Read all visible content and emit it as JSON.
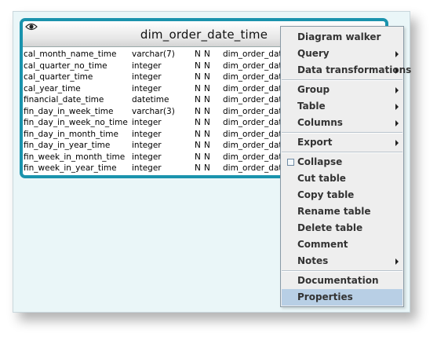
{
  "table": {
    "title": "dim_order_date_time",
    "rows": [
      {
        "name": "cal_month_name_time",
        "type": "varchar(7)",
        "n1": "N",
        "n2": "N",
        "ref": "dim_order_date"
      },
      {
        "name": "cal_quarter_no_time",
        "type": "integer",
        "n1": "N",
        "n2": "N",
        "ref": "dim_order_date"
      },
      {
        "name": "cal_quarter_time",
        "type": "integer",
        "n1": "N",
        "n2": "N",
        "ref": "dim_order_date"
      },
      {
        "name": "cal_year_time",
        "type": "integer",
        "n1": "N",
        "n2": "N",
        "ref": "dim_order_date"
      },
      {
        "name": "financial_date_time",
        "type": "datetime",
        "n1": "N",
        "n2": "N",
        "ref": "dim_order_date"
      },
      {
        "name": "fin_day_in_week_time",
        "type": "varchar(3)",
        "n1": "N",
        "n2": "N",
        "ref": "dim_order_date"
      },
      {
        "name": "fin_day_in_week_no_time",
        "type": "integer",
        "n1": "N",
        "n2": "N",
        "ref": "dim_order_date"
      },
      {
        "name": "fin_day_in_month_time",
        "type": "integer",
        "n1": "N",
        "n2": "N",
        "ref": "dim_order_date"
      },
      {
        "name": "fin_day_in_year_time",
        "type": "integer",
        "n1": "N",
        "n2": "N",
        "ref": "dim_order_date"
      },
      {
        "name": "fin_week_in_month_time",
        "type": "integer",
        "n1": "N",
        "n2": "N",
        "ref": "dim_order_date"
      },
      {
        "name": "fin_week_in_year_time",
        "type": "integer",
        "n1": "N",
        "n2": "N",
        "ref": "dim_order_date"
      }
    ]
  },
  "menu": {
    "diagram_walker": "Diagram walker",
    "query": "Query",
    "data_transformations": "Data transformations",
    "group": "Group",
    "table": "Table",
    "columns": "Columns",
    "export": "Export",
    "collapse": "Collapse",
    "cut_table": "Cut table",
    "copy_table": "Copy table",
    "rename_table": "Rename table",
    "delete_table": "Delete table",
    "comment": "Comment",
    "notes": "Notes",
    "documentation": "Documentation",
    "properties": "Properties"
  },
  "colors": {
    "table_border": "#1a93ad",
    "canvas_bg": "#eaf6f8",
    "menu_bg": "#eeeeee",
    "menu_selected": "#b8cfe5"
  }
}
